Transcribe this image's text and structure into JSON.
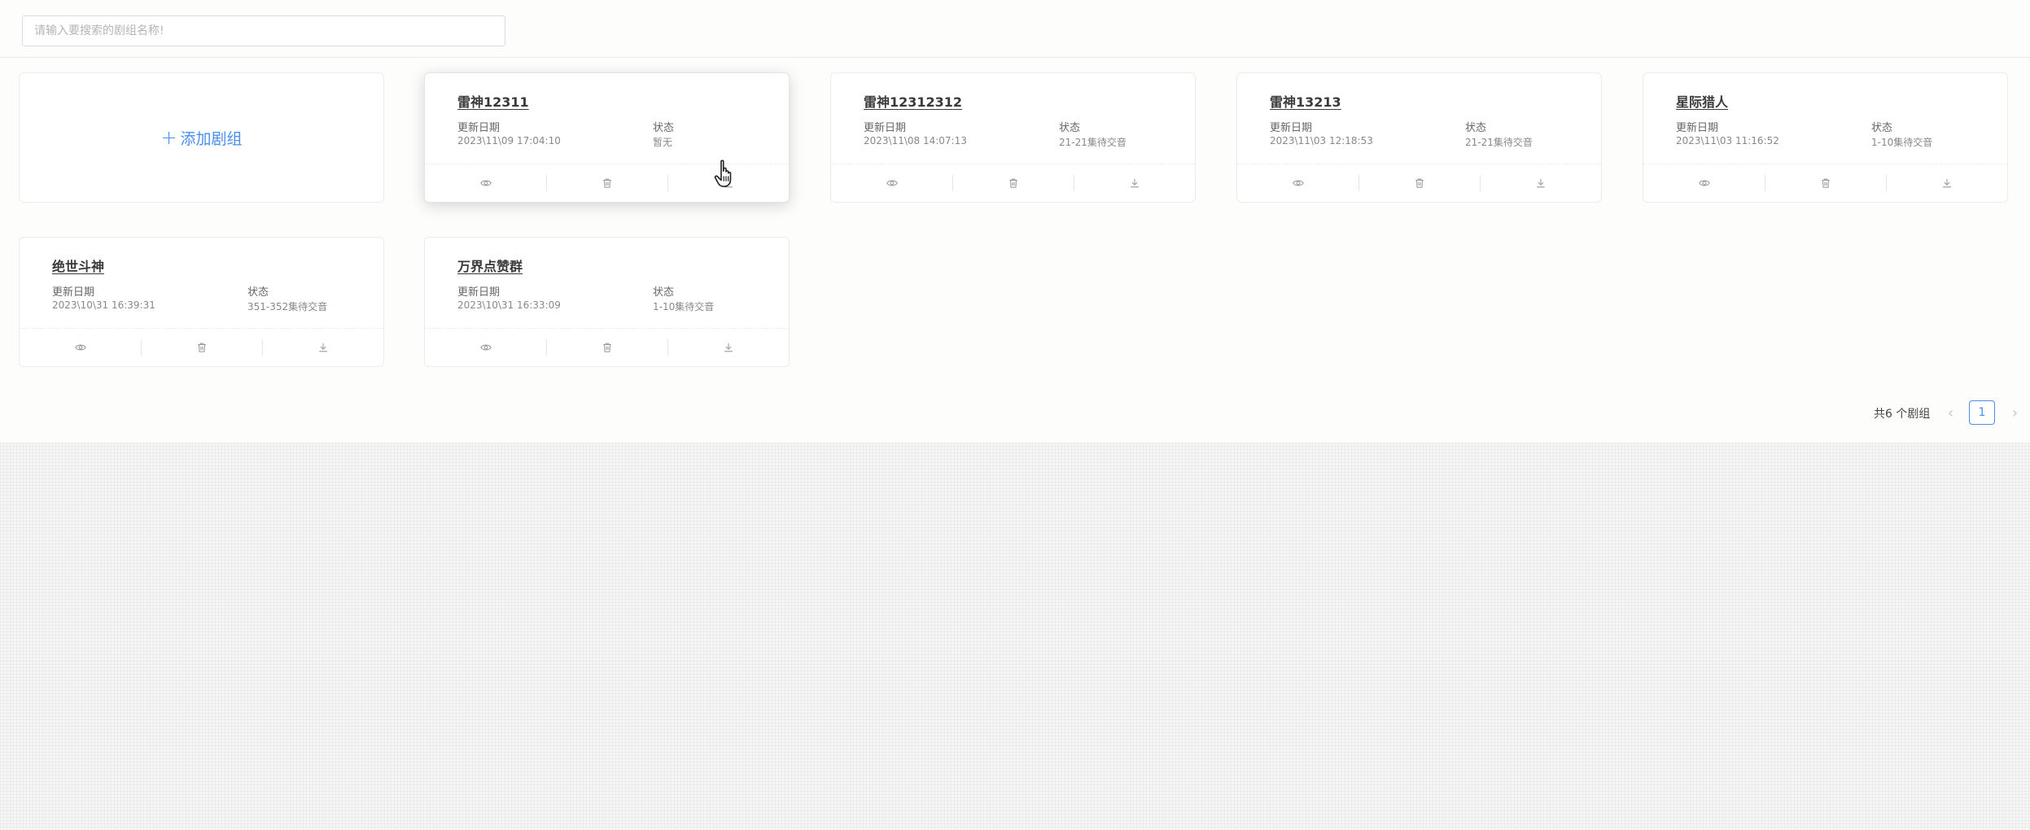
{
  "search": {
    "placeholder": "请输入要搜索的剧组名称!",
    "value": ""
  },
  "add_card": {
    "label": "添加剧组"
  },
  "field_labels": {
    "updated": "更新日期",
    "status": "状态"
  },
  "cards": [
    {
      "title": "雷神12311",
      "updated": "2023\\11\\09 17:04:10",
      "status": "暂无",
      "hovered": true
    },
    {
      "title": "雷神12312312",
      "updated": "2023\\11\\08 14:07:13",
      "status": "21-21集待交音"
    },
    {
      "title": "雷神13213",
      "updated": "2023\\11\\03 12:18:53",
      "status": "21-21集待交音"
    },
    {
      "title": "星际猎人",
      "updated": "2023\\11\\03 11:16:52",
      "status": "1-10集待交音"
    },
    {
      "title": "绝世斗神",
      "updated": "2023\\10\\31 16:39:31",
      "status": "351-352集待交音"
    },
    {
      "title": "万界点赞群",
      "updated": "2023\\10\\31 16:33:09",
      "status": "1-10集待交音"
    }
  ],
  "card_action_icons": [
    "eye-icon",
    "trash-icon",
    "download-icon"
  ],
  "pagination": {
    "total_label": "共6 个剧组",
    "current_page": "1",
    "prev_icon": "chevron-left-icon",
    "next_icon": "chevron-right-icon"
  },
  "colors": {
    "accent": "#4a8ef0",
    "title": "#3a3a3a",
    "muted": "#888888"
  }
}
